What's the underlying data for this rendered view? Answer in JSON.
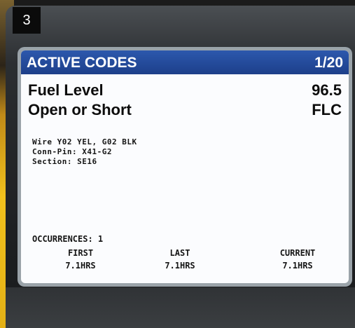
{
  "step_number": "3",
  "screen": {
    "title": "ACTIVE CODES",
    "page_indicator": "1/20",
    "fault": {
      "name": "Fuel Level",
      "value": "96.5",
      "condition": "Open or Short",
      "code": "FLC"
    },
    "details": [
      "Wire Y02 YEL, G02 BLK",
      "Conn-Pin: X41-G2",
      "Section: SE16"
    ],
    "occurrences_label": "OCCURRENCES: 1",
    "columns": [
      {
        "header": "FIRST",
        "value": "7.1HRS"
      },
      {
        "header": "LAST",
        "value": "7.1HRS"
      },
      {
        "header": "CURRENT",
        "value": "7.1HRS"
      }
    ]
  }
}
